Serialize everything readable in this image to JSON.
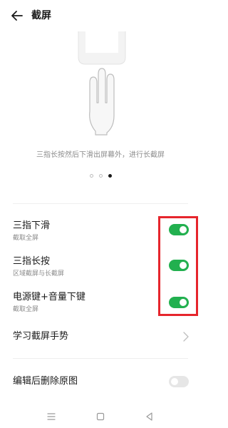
{
  "header": {
    "title": "截屏",
    "back_icon": "arrow-left-icon"
  },
  "illustration": {
    "caption": "三指长按然后下滑出屏幕外，进行长截屏",
    "page_count": 3,
    "active_page": 3
  },
  "settings": {
    "three_finger_swipe": {
      "title": "三指下滑",
      "subtitle": "截取全屏",
      "enabled": true
    },
    "three_finger_hold": {
      "title": "三指长按",
      "subtitle": "区域截屏与长截屏",
      "enabled": true
    },
    "power_volume_down": {
      "title": "电源键+音量下键",
      "subtitle": "截取全屏",
      "enabled": true
    },
    "learn_gestures": {
      "title": "学习截屏手势"
    },
    "delete_after_edit": {
      "title": "编辑后删除原图",
      "enabled": false
    }
  },
  "colors": {
    "toggle_on": "#22b04f",
    "toggle_off": "#e6e6e6",
    "highlight": "#e6252c"
  },
  "navbar": {
    "icons": [
      "menu-icon",
      "home-icon",
      "back-triangle-icon"
    ]
  }
}
